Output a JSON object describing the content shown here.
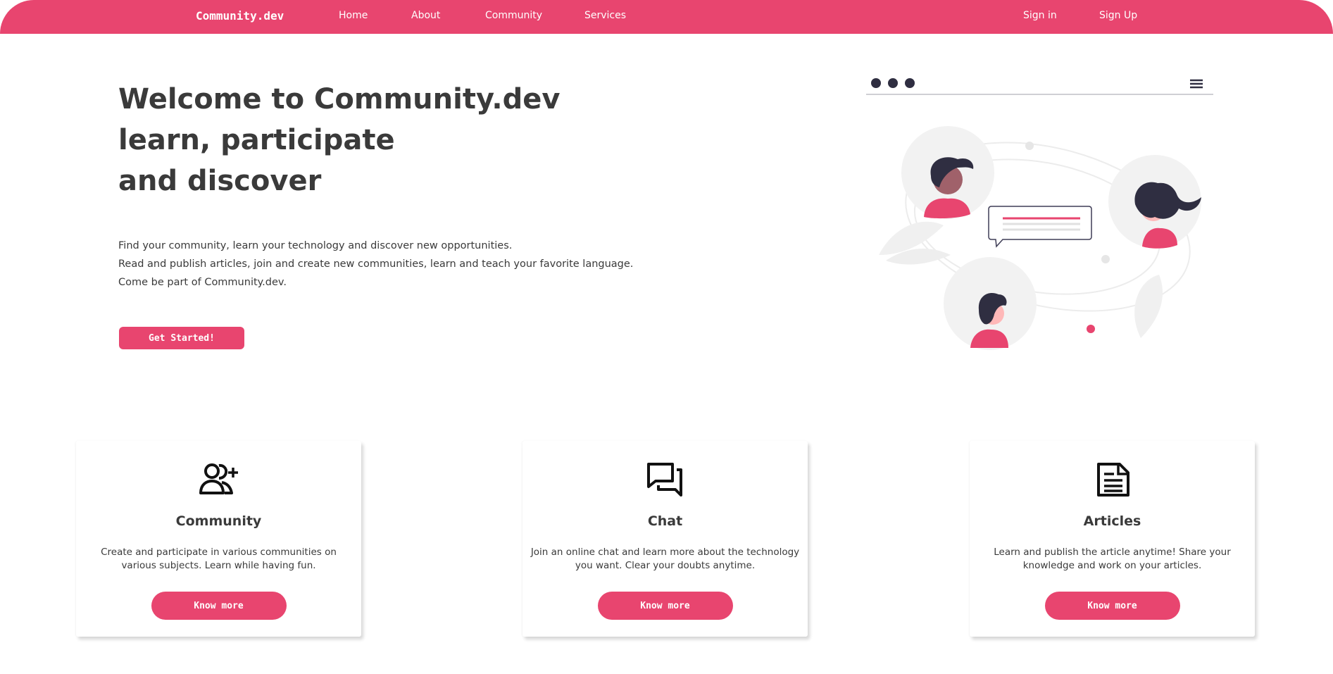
{
  "colors": {
    "accent": "#e8456f",
    "text": "#3a3a3a",
    "illustration_dark": "#2f2e41",
    "illustration_light": "#f2f2f2"
  },
  "nav": {
    "brand": "Community.dev",
    "links": [
      "Home",
      "About",
      "Community",
      "Services"
    ],
    "auth": {
      "sign_in": "Sign in",
      "sign_up": "Sign Up"
    }
  },
  "hero": {
    "title_lines": [
      "Welcome to Community.dev",
      "learn, participate",
      "and discover"
    ],
    "description_lines": [
      "Find your community, learn your technology and discover new opportunities.",
      "Read and publish articles, join and create new communities, learn and teach your favorite language.",
      "Come be part of Community.dev."
    ],
    "cta_label": "Get Started!"
  },
  "illustration": {
    "icons": [
      "window-dots-icon",
      "hamburger-menu-icon",
      "person-avatar-icon",
      "chat-bubble-icon"
    ]
  },
  "cards": [
    {
      "icon": "add-user-icon",
      "title": "Community",
      "text": "Create and participate in various communities on various subjects. Learn while having fun.",
      "button": "Know more"
    },
    {
      "icon": "chat-icon",
      "title": "Chat",
      "text": "Join an online chat and learn more about the technology you want. Clear your doubts anytime.",
      "button": "Know more"
    },
    {
      "icon": "article-icon",
      "title": "Articles",
      "text": "Learn and publish the article anytime! Share your knowledge and work on your articles.",
      "button": "Know more"
    }
  ]
}
